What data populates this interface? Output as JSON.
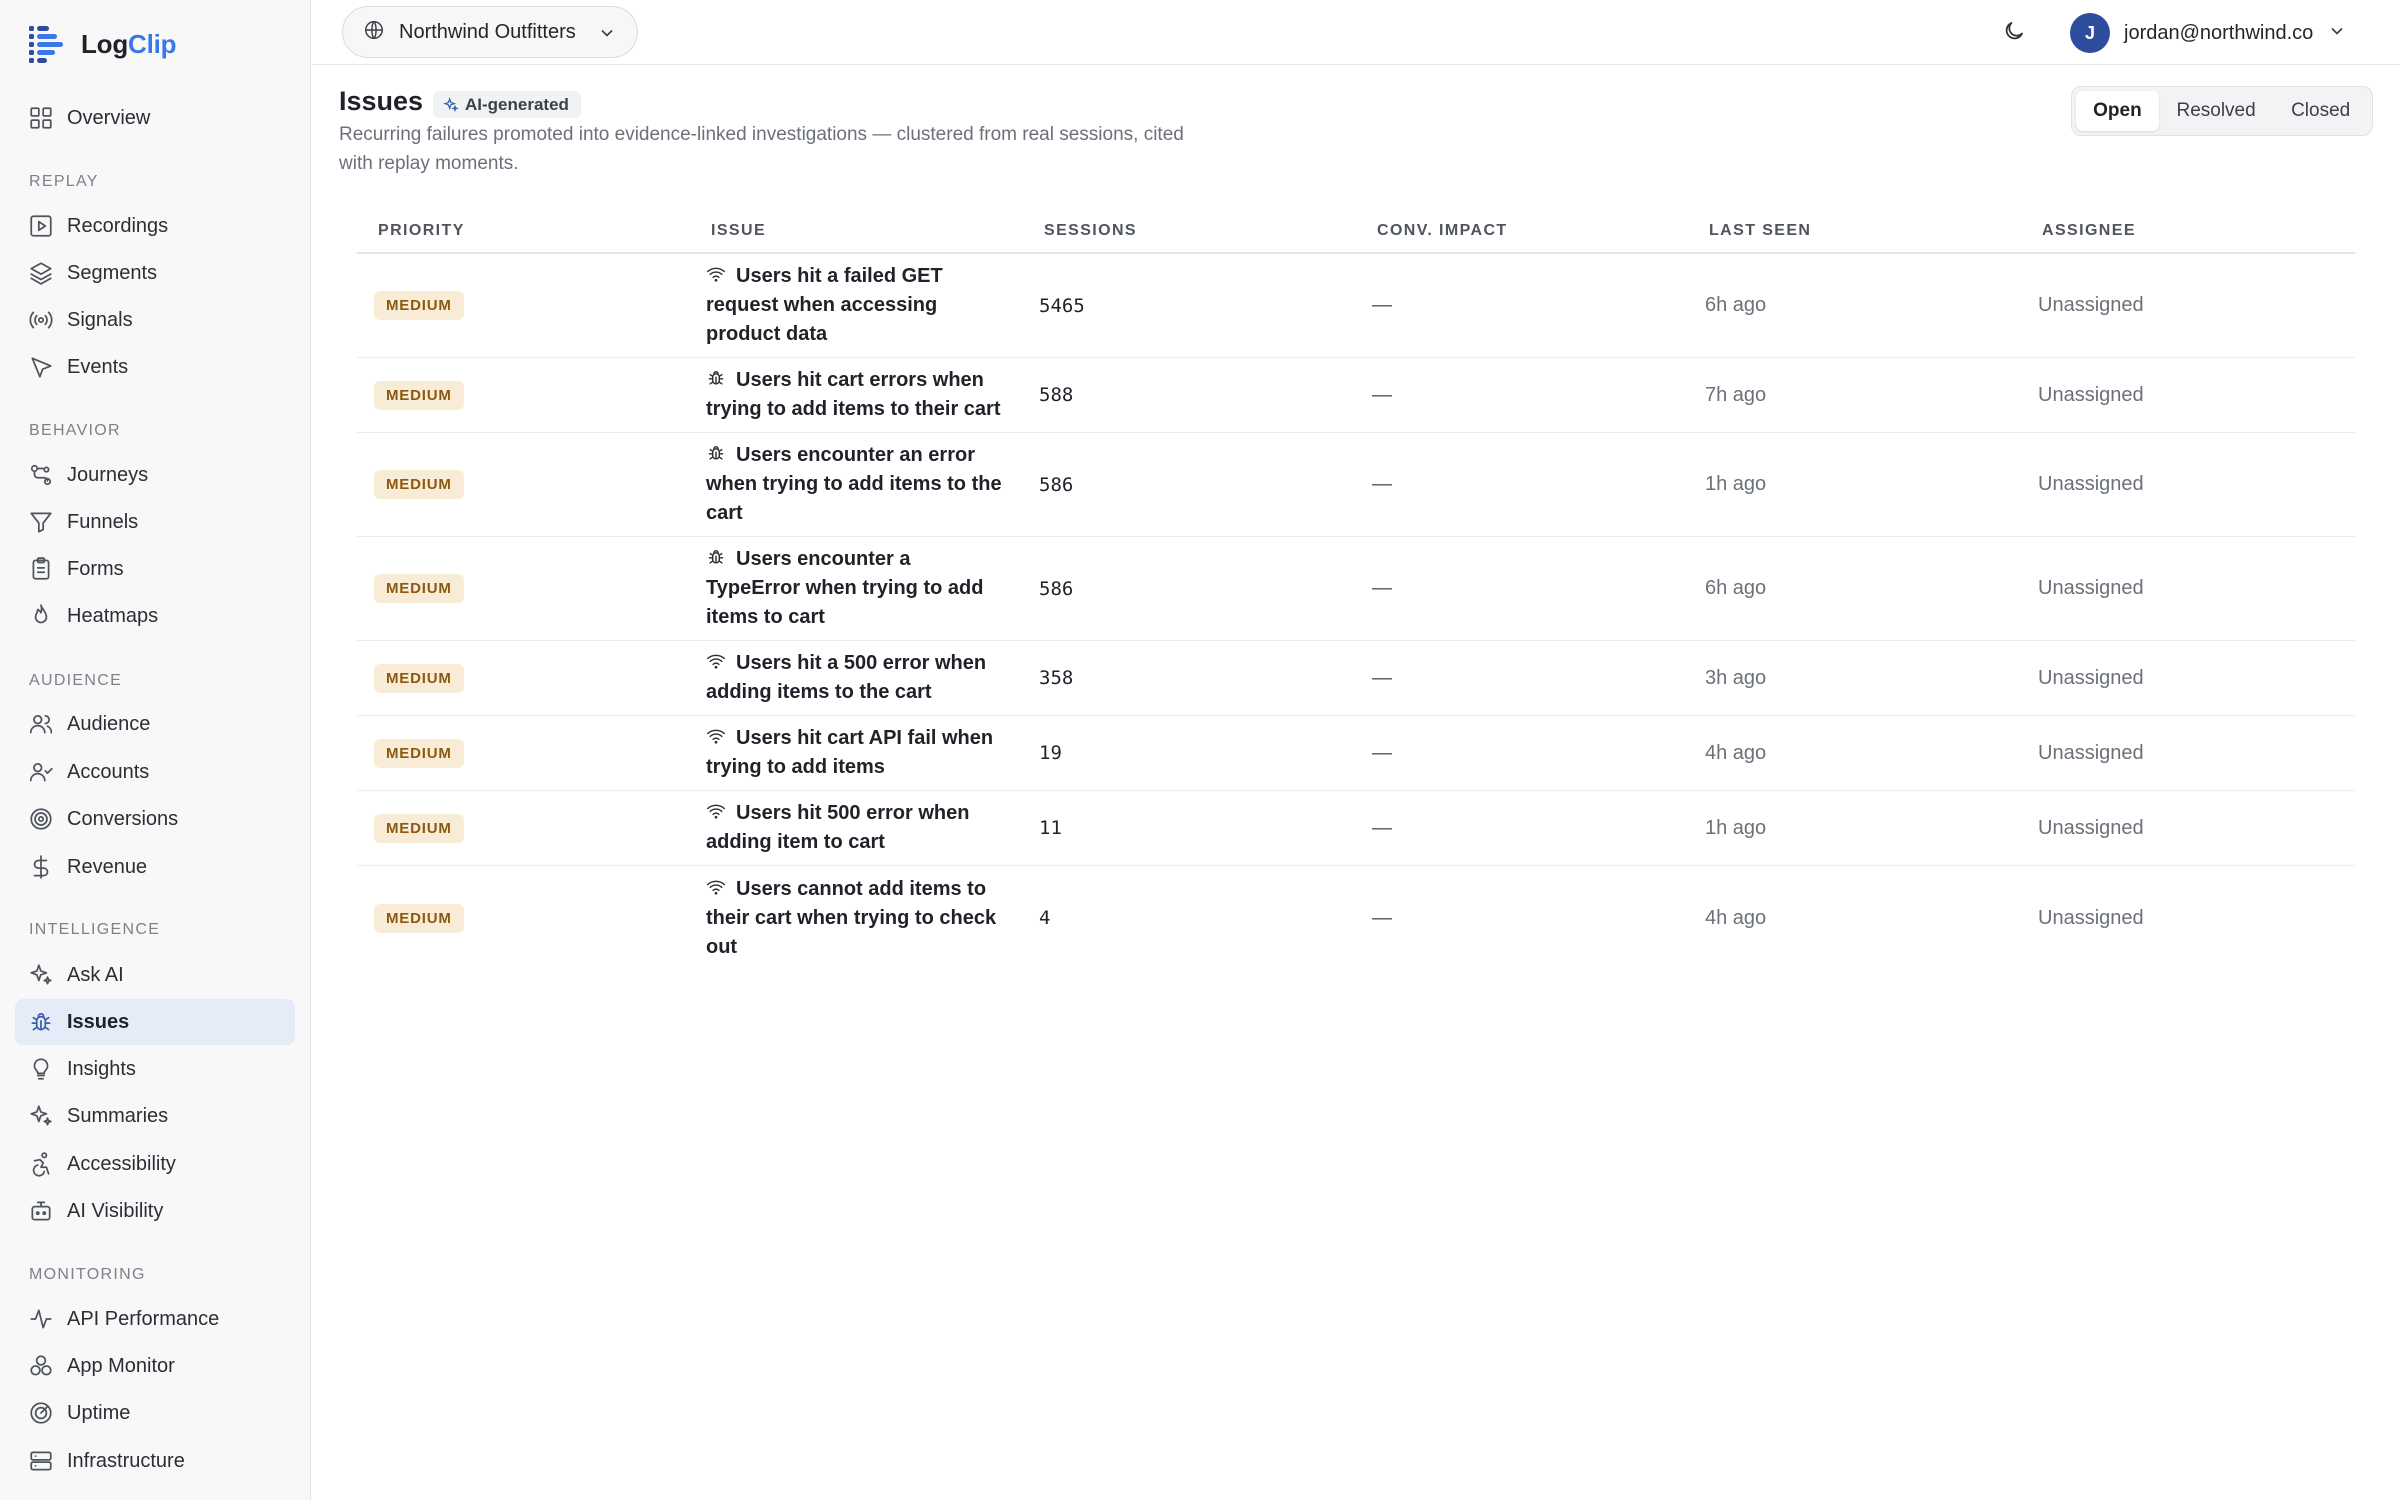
{
  "app": {
    "logo_part1": "Log",
    "logo_part2": "Clip",
    "colors": {
      "brand": "#3b78e7",
      "active_bg": "#e5ecf8",
      "badge_bg": "#f8ecd7",
      "badge_text": "#8a5a10"
    }
  },
  "sidebar": {
    "overview": "Overview",
    "sections": {
      "replay": "REPLAY",
      "behavior": "BEHAVIOR",
      "audience": "AUDIENCE",
      "intelligence": "INTELLIGENCE",
      "monitoring": "MONITORING"
    },
    "items": [
      {
        "label": "Recordings",
        "icon": "play-square-icon"
      },
      {
        "label": "Segments",
        "icon": "layers-icon"
      },
      {
        "label": "Signals",
        "icon": "radio-icon"
      },
      {
        "label": "Events",
        "icon": "cursor-icon"
      },
      {
        "label": "Journeys",
        "icon": "route-icon"
      },
      {
        "label": "Funnels",
        "icon": "funnel-icon"
      },
      {
        "label": "Forms",
        "icon": "clipboard-icon"
      },
      {
        "label": "Heatmaps",
        "icon": "flame-icon"
      },
      {
        "label": "Audience",
        "icon": "users-icon"
      },
      {
        "label": "Accounts",
        "icon": "user-check-icon"
      },
      {
        "label": "Conversions",
        "icon": "target-icon"
      },
      {
        "label": "Revenue",
        "icon": "dollar-icon"
      },
      {
        "label": "Ask AI",
        "icon": "sparkles-icon"
      },
      {
        "label": "Issues",
        "icon": "bug-icon",
        "active": true
      },
      {
        "label": "Insights",
        "icon": "lightbulb-icon"
      },
      {
        "label": "Summaries",
        "icon": "sparkles-icon"
      },
      {
        "label": "Accessibility",
        "icon": "accessibility-icon"
      },
      {
        "label": "AI Visibility",
        "icon": "bot-icon"
      },
      {
        "label": "API Performance",
        "icon": "activity-icon"
      },
      {
        "label": "App Monitor",
        "icon": "cog-nodes-icon"
      },
      {
        "label": "Uptime",
        "icon": "radar-icon"
      },
      {
        "label": "Infrastructure",
        "icon": "server-icon"
      }
    ]
  },
  "topbar": {
    "workspace": "Northwind Outfitters",
    "user_initial": "J",
    "user_email": "jordan@northwind.co"
  },
  "page": {
    "title": "Issues",
    "ai_badge": "AI-generated",
    "subtitle": "Recurring failures promoted into evidence-linked investigations — clustered from real sessions, cited with replay moments.",
    "filters": [
      "Open",
      "Resolved",
      "Closed"
    ],
    "active_filter": "Open"
  },
  "table": {
    "columns": [
      "PRIORITY",
      "ISSUE",
      "SESSIONS",
      "CONV. IMPACT",
      "LAST SEEN",
      "ASSIGNEE"
    ],
    "rows": [
      {
        "priority": "MEDIUM",
        "icon": "wifi-icon",
        "issue": "Users hit a failed GET request when accessing product data",
        "sessions": "5465",
        "impact": "—",
        "last_seen": "6h ago",
        "assignee": "Unassigned"
      },
      {
        "priority": "MEDIUM",
        "icon": "bug-icon",
        "issue": "Users hit cart errors when trying to add items to their cart",
        "sessions": "588",
        "impact": "—",
        "last_seen": "7h ago",
        "assignee": "Unassigned"
      },
      {
        "priority": "MEDIUM",
        "icon": "bug-icon",
        "issue": "Users encounter an error when trying to add items to the cart",
        "sessions": "586",
        "impact": "—",
        "last_seen": "1h ago",
        "assignee": "Unassigned"
      },
      {
        "priority": "MEDIUM",
        "icon": "bug-icon",
        "issue": "Users encounter a TypeError when trying to add items to cart",
        "sessions": "586",
        "impact": "—",
        "last_seen": "6h ago",
        "assignee": "Unassigned"
      },
      {
        "priority": "MEDIUM",
        "icon": "wifi-icon",
        "issue": "Users hit a 500 error when adding items to the cart",
        "sessions": "358",
        "impact": "—",
        "last_seen": "3h ago",
        "assignee": "Unassigned"
      },
      {
        "priority": "MEDIUM",
        "icon": "wifi-icon",
        "issue": "Users hit cart API fail when trying to add items",
        "sessions": "19",
        "impact": "—",
        "last_seen": "4h ago",
        "assignee": "Unassigned"
      },
      {
        "priority": "MEDIUM",
        "icon": "wifi-icon",
        "issue": "Users hit 500 error when adding item to cart",
        "sessions": "11",
        "impact": "—",
        "last_seen": "1h ago",
        "assignee": "Unassigned"
      },
      {
        "priority": "MEDIUM",
        "icon": "wifi-icon",
        "issue": "Users cannot add items to their cart when trying to check out",
        "sessions": "4",
        "impact": "—",
        "last_seen": "4h ago",
        "assignee": "Unassigned"
      }
    ]
  }
}
